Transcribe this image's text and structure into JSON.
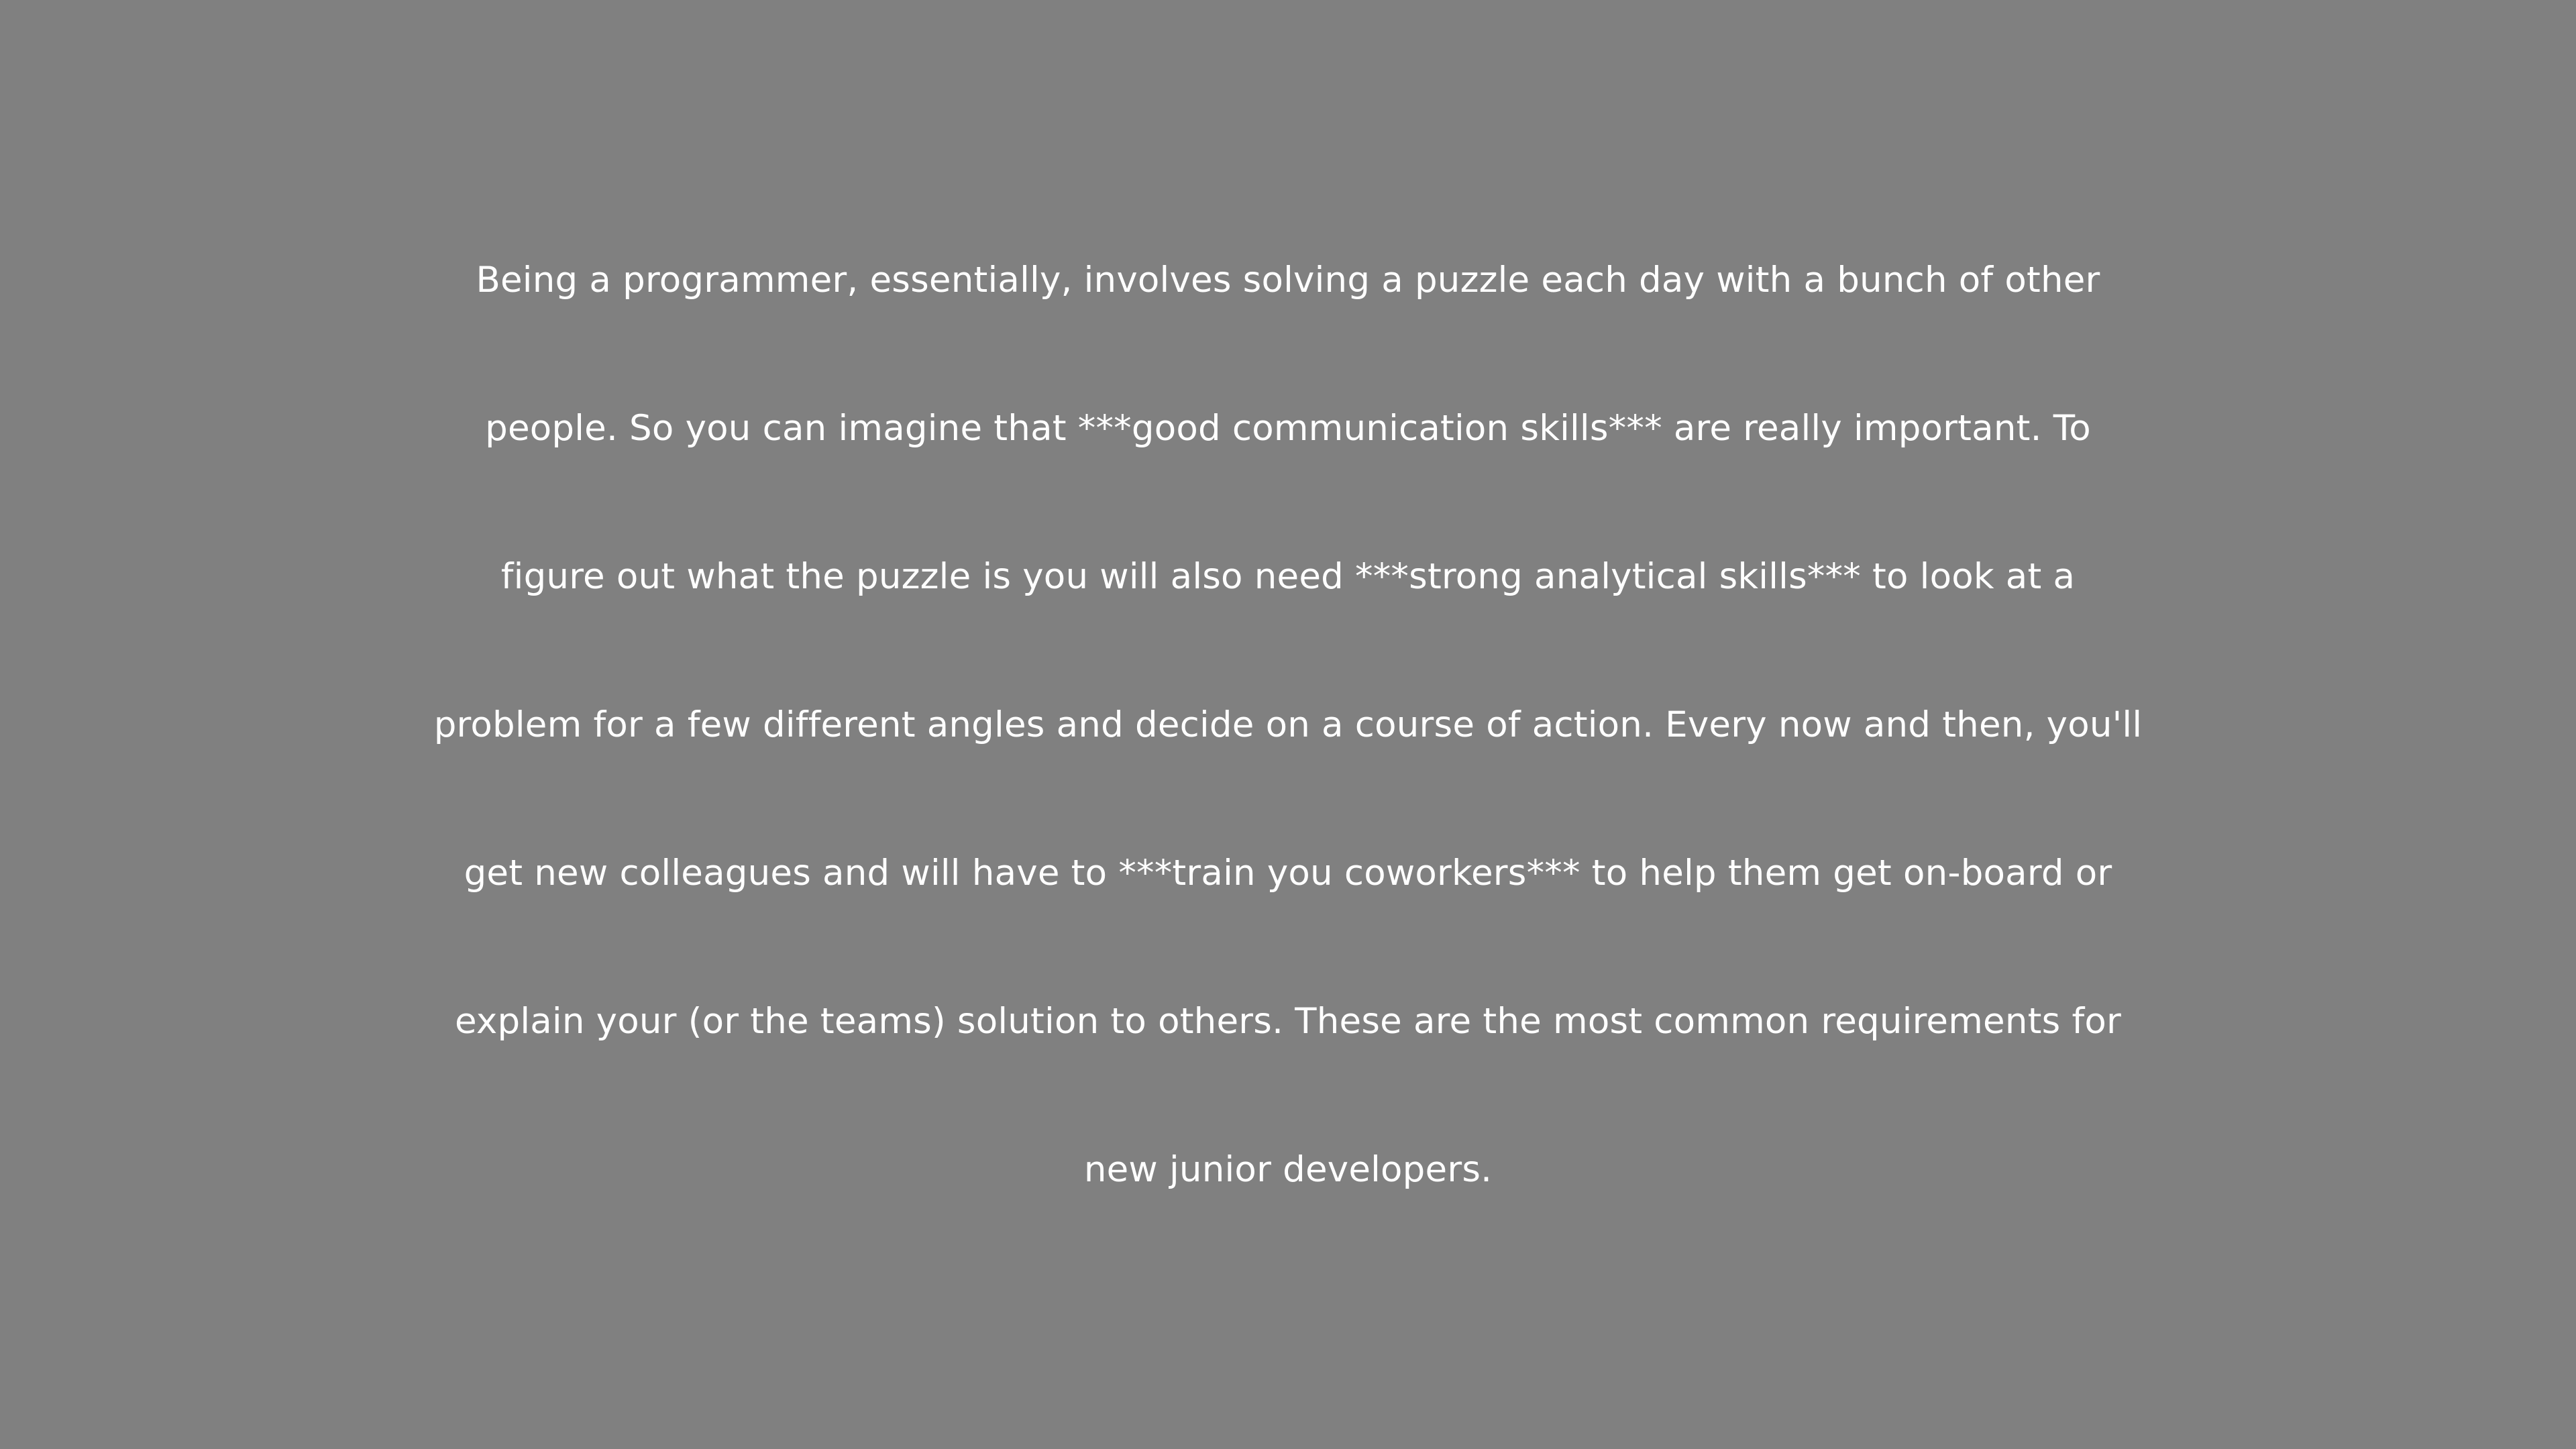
{
  "paragraph": {
    "lines": [
      "Being a programmer, essentially, involves solving a puzzle each day with a bunch of other",
      "people. So you can imagine that ***good communication skills*** are really important. To",
      "figure out what the puzzle is you will also need ***strong analytical skills*** to look at a",
      "problem for a few different angles and decide on a course of action. Every now and then, you'll",
      "get new colleagues and will have to ***train you coworkers*** to help them get on-board or",
      "explain your (or the teams) solution to others. These are the most common requirements for",
      "new junior developers."
    ]
  },
  "colors": {
    "background": "#808080",
    "text": "#ffffff"
  }
}
